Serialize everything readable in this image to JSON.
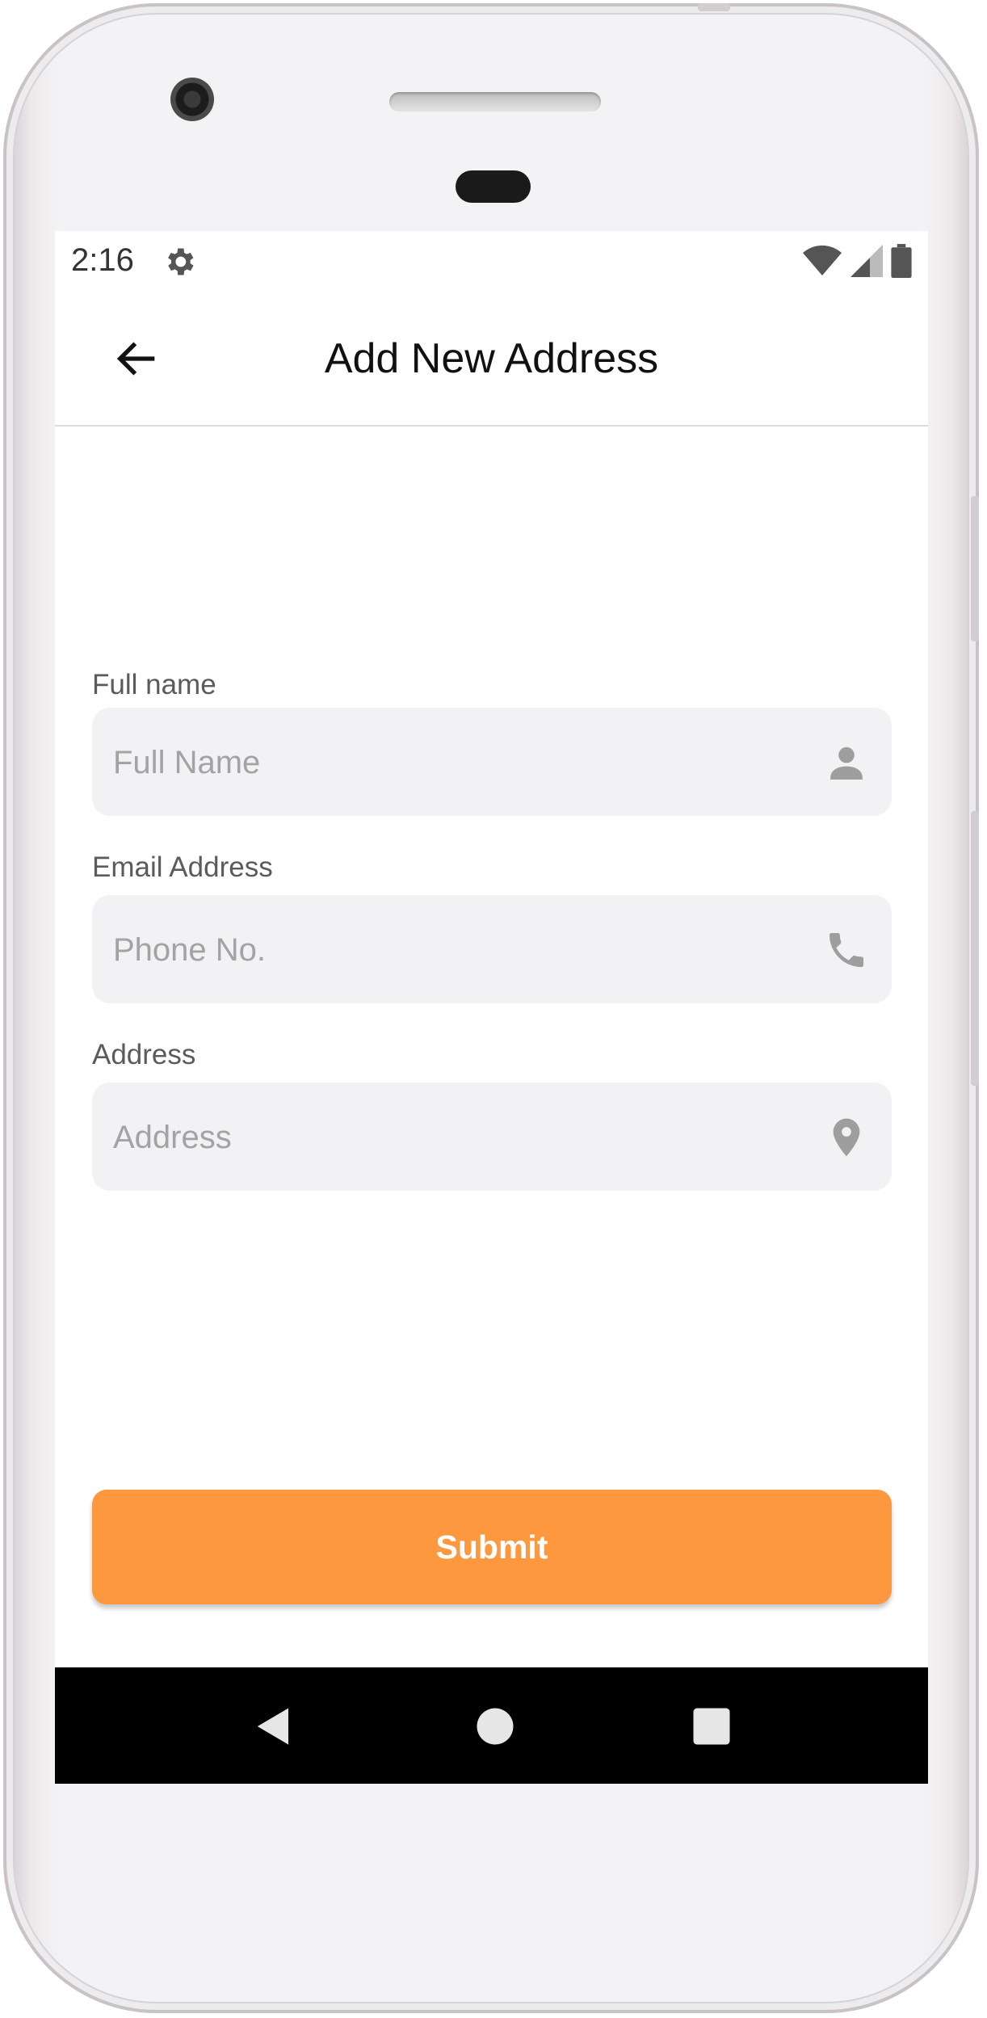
{
  "status_bar": {
    "time": "2:16"
  },
  "app_bar": {
    "title": "Add New Address"
  },
  "form": {
    "fields": [
      {
        "label": "Full name",
        "placeholder": "Full Name",
        "icon": "person-icon"
      },
      {
        "label": "Email Address",
        "placeholder": "Phone No.",
        "icon": "phone-icon"
      },
      {
        "label": "Address",
        "placeholder": "Address",
        "icon": "location-pin-icon"
      }
    ],
    "submit_label": "Submit"
  },
  "colors": {
    "accent": "#fd983e",
    "field_background": "#f2f2f4",
    "nav_bar": "#000000"
  },
  "nav_bar": {
    "icons": [
      "back-triangle-icon",
      "home-circle-icon",
      "recents-square-icon"
    ]
  }
}
